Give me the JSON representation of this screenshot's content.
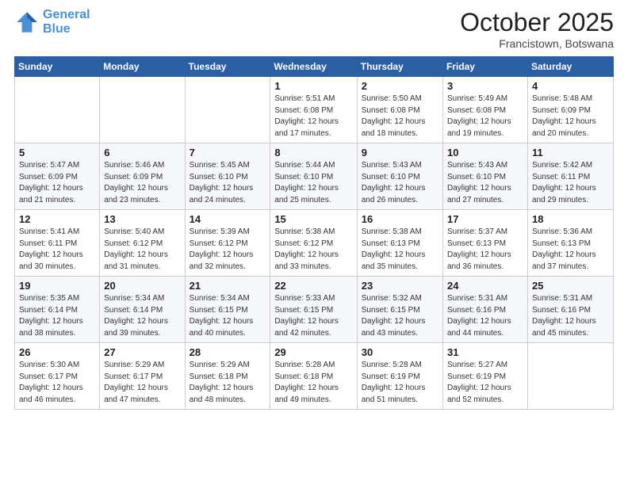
{
  "header": {
    "logo_line1": "General",
    "logo_line2": "Blue",
    "month": "October 2025",
    "location": "Francistown, Botswana"
  },
  "weekdays": [
    "Sunday",
    "Monday",
    "Tuesday",
    "Wednesday",
    "Thursday",
    "Friday",
    "Saturday"
  ],
  "weeks": [
    [
      {
        "day": "",
        "info": ""
      },
      {
        "day": "",
        "info": ""
      },
      {
        "day": "",
        "info": ""
      },
      {
        "day": "1",
        "info": "Sunrise: 5:51 AM\nSunset: 6:08 PM\nDaylight: 12 hours\nand 17 minutes."
      },
      {
        "day": "2",
        "info": "Sunrise: 5:50 AM\nSunset: 6:08 PM\nDaylight: 12 hours\nand 18 minutes."
      },
      {
        "day": "3",
        "info": "Sunrise: 5:49 AM\nSunset: 6:08 PM\nDaylight: 12 hours\nand 19 minutes."
      },
      {
        "day": "4",
        "info": "Sunrise: 5:48 AM\nSunset: 6:09 PM\nDaylight: 12 hours\nand 20 minutes."
      }
    ],
    [
      {
        "day": "5",
        "info": "Sunrise: 5:47 AM\nSunset: 6:09 PM\nDaylight: 12 hours\nand 21 minutes."
      },
      {
        "day": "6",
        "info": "Sunrise: 5:46 AM\nSunset: 6:09 PM\nDaylight: 12 hours\nand 23 minutes."
      },
      {
        "day": "7",
        "info": "Sunrise: 5:45 AM\nSunset: 6:10 PM\nDaylight: 12 hours\nand 24 minutes."
      },
      {
        "day": "8",
        "info": "Sunrise: 5:44 AM\nSunset: 6:10 PM\nDaylight: 12 hours\nand 25 minutes."
      },
      {
        "day": "9",
        "info": "Sunrise: 5:43 AM\nSunset: 6:10 PM\nDaylight: 12 hours\nand 26 minutes."
      },
      {
        "day": "10",
        "info": "Sunrise: 5:43 AM\nSunset: 6:10 PM\nDaylight: 12 hours\nand 27 minutes."
      },
      {
        "day": "11",
        "info": "Sunrise: 5:42 AM\nSunset: 6:11 PM\nDaylight: 12 hours\nand 29 minutes."
      }
    ],
    [
      {
        "day": "12",
        "info": "Sunrise: 5:41 AM\nSunset: 6:11 PM\nDaylight: 12 hours\nand 30 minutes."
      },
      {
        "day": "13",
        "info": "Sunrise: 5:40 AM\nSunset: 6:12 PM\nDaylight: 12 hours\nand 31 minutes."
      },
      {
        "day": "14",
        "info": "Sunrise: 5:39 AM\nSunset: 6:12 PM\nDaylight: 12 hours\nand 32 minutes."
      },
      {
        "day": "15",
        "info": "Sunrise: 5:38 AM\nSunset: 6:12 PM\nDaylight: 12 hours\nand 33 minutes."
      },
      {
        "day": "16",
        "info": "Sunrise: 5:38 AM\nSunset: 6:13 PM\nDaylight: 12 hours\nand 35 minutes."
      },
      {
        "day": "17",
        "info": "Sunrise: 5:37 AM\nSunset: 6:13 PM\nDaylight: 12 hours\nand 36 minutes."
      },
      {
        "day": "18",
        "info": "Sunrise: 5:36 AM\nSunset: 6:13 PM\nDaylight: 12 hours\nand 37 minutes."
      }
    ],
    [
      {
        "day": "19",
        "info": "Sunrise: 5:35 AM\nSunset: 6:14 PM\nDaylight: 12 hours\nand 38 minutes."
      },
      {
        "day": "20",
        "info": "Sunrise: 5:34 AM\nSunset: 6:14 PM\nDaylight: 12 hours\nand 39 minutes."
      },
      {
        "day": "21",
        "info": "Sunrise: 5:34 AM\nSunset: 6:15 PM\nDaylight: 12 hours\nand 40 minutes."
      },
      {
        "day": "22",
        "info": "Sunrise: 5:33 AM\nSunset: 6:15 PM\nDaylight: 12 hours\nand 42 minutes."
      },
      {
        "day": "23",
        "info": "Sunrise: 5:32 AM\nSunset: 6:15 PM\nDaylight: 12 hours\nand 43 minutes."
      },
      {
        "day": "24",
        "info": "Sunrise: 5:31 AM\nSunset: 6:16 PM\nDaylight: 12 hours\nand 44 minutes."
      },
      {
        "day": "25",
        "info": "Sunrise: 5:31 AM\nSunset: 6:16 PM\nDaylight: 12 hours\nand 45 minutes."
      }
    ],
    [
      {
        "day": "26",
        "info": "Sunrise: 5:30 AM\nSunset: 6:17 PM\nDaylight: 12 hours\nand 46 minutes."
      },
      {
        "day": "27",
        "info": "Sunrise: 5:29 AM\nSunset: 6:17 PM\nDaylight: 12 hours\nand 47 minutes."
      },
      {
        "day": "28",
        "info": "Sunrise: 5:29 AM\nSunset: 6:18 PM\nDaylight: 12 hours\nand 48 minutes."
      },
      {
        "day": "29",
        "info": "Sunrise: 5:28 AM\nSunset: 6:18 PM\nDaylight: 12 hours\nand 49 minutes."
      },
      {
        "day": "30",
        "info": "Sunrise: 5:28 AM\nSunset: 6:19 PM\nDaylight: 12 hours\nand 51 minutes."
      },
      {
        "day": "31",
        "info": "Sunrise: 5:27 AM\nSunset: 6:19 PM\nDaylight: 12 hours\nand 52 minutes."
      },
      {
        "day": "",
        "info": ""
      }
    ]
  ]
}
